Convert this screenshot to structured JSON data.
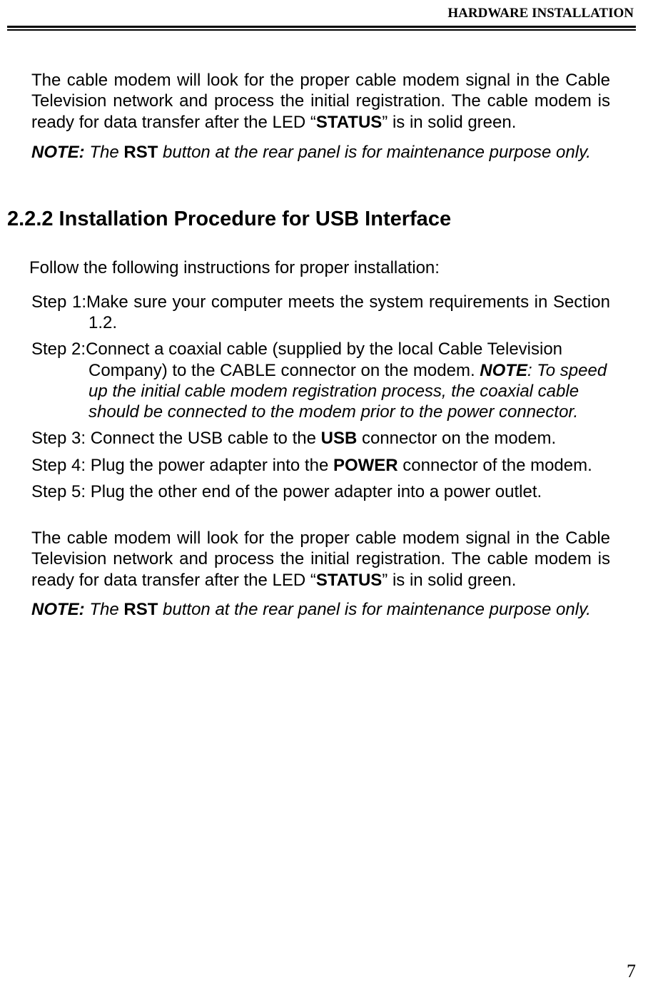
{
  "header": "HARDWARE INSTALLATION",
  "para1_a": "The cable modem will look for the proper cable modem signal in the Cable Television network and process the initial registration. The cable modem is ready for data transfer after the LED “",
  "para1_b": "STATUS",
  "para1_c": "” is in solid green.",
  "note1_a": "NOTE:",
  "note1_b": " The ",
  "note1_c": "RST",
  "note1_d": " button at the rear panel is for maintenance purpose only.",
  "section_heading": "2.2.2 Installation Procedure for USB Interface",
  "intro": "Follow the following instructions for proper installation:",
  "step1_label": "Step 1:",
  "step1_text": "Make sure your computer meets the system requirements in Section 1.2.",
  "step2_label": "Step 2:",
  "step2_a": "Connect a coaxial cable (supplied by the local Cable Television Company) to the CABLE connector on the modem. ",
  "step2_b": "NOTE",
  "step2_c": ": To speed up the initial cable modem registration process, the coaxial cable should be connected to the modem prior to the power connector.",
  "step3_label": "Step 3: ",
  "step3_a": "Connect the USB cable to the ",
  "step3_b": "USB",
  "step3_c": " connector on the modem.",
  "step4_label": "Step 4: ",
  "step4_a": "Plug the power adapter into the ",
  "step4_b": "POWER",
  "step4_c": " connector of the modem.",
  "step5_label": "Step 5: ",
  "step5_a": "Plug the other end of the power adapter into a power outlet.",
  "para2_a": "The cable modem will look for the proper cable modem signal in the Cable Television network and process the initial registration. The cable modem is ready for data transfer after the LED “",
  "para2_b": "STATUS",
  "para2_c": "” is in solid green.",
  "note2_a": "NOTE:",
  "note2_b": " The ",
  "note2_c": "RST",
  "note2_d": " button at the rear panel is for maintenance purpose only.",
  "page_number": "7"
}
